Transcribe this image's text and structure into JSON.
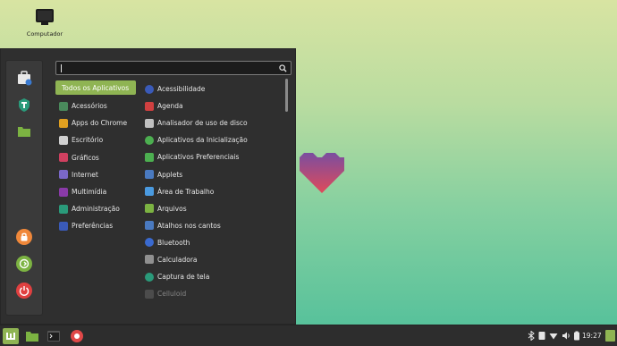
{
  "desktop": {
    "icon_label": "Computador"
  },
  "search": {
    "value": ""
  },
  "categories": [
    {
      "label": "Todos os Aplicativos",
      "icon": "all-apps",
      "color": "#8fb453",
      "active": true
    },
    {
      "label": "Acessórios",
      "icon": "accessories-icon",
      "color": "#4a8a5c"
    },
    {
      "label": "Apps do Chrome",
      "icon": "chrome-icon",
      "color": "#e0a020"
    },
    {
      "label": "Escritório",
      "icon": "office-icon",
      "color": "#d0d0d0"
    },
    {
      "label": "Gráficos",
      "icon": "graphics-icon",
      "color": "#d04060"
    },
    {
      "label": "Internet",
      "icon": "internet-icon",
      "color": "#7a68c8"
    },
    {
      "label": "Multimídia",
      "icon": "multimedia-icon",
      "color": "#8a3aa8"
    },
    {
      "label": "Administração",
      "icon": "administration-icon",
      "color": "#2a9a7a"
    },
    {
      "label": "Preferências",
      "icon": "preferences-icon",
      "color": "#3a5ab8"
    }
  ],
  "apps": [
    {
      "label": "Acessibilidade",
      "icon": "accessibility-icon",
      "color": "#3a5ab8"
    },
    {
      "label": "Agenda",
      "icon": "calendar-icon",
      "color": "#d04040"
    },
    {
      "label": "Analisador de uso de disco",
      "icon": "disk-usage-icon",
      "color": "#c0c0c0"
    },
    {
      "label": "Aplicativos da Inicialização",
      "icon": "startup-apps-icon",
      "color": "#4caf50"
    },
    {
      "label": "Aplicativos Preferenciais",
      "icon": "preferred-apps-icon",
      "color": "#4caf50"
    },
    {
      "label": "Applets",
      "icon": "applets-icon",
      "color": "#4a7ac0"
    },
    {
      "label": "Área de Trabalho",
      "icon": "desktop-icon",
      "color": "#4a9ae0"
    },
    {
      "label": "Arquivos",
      "icon": "files-icon",
      "color": "#7cb342"
    },
    {
      "label": "Atalhos nos cantos",
      "icon": "hot-corners-icon",
      "color": "#4a7ac0"
    },
    {
      "label": "Bluetooth",
      "icon": "bluetooth-icon",
      "color": "#3a6ad0"
    },
    {
      "label": "Calculadora",
      "icon": "calculator-icon",
      "color": "#909090"
    },
    {
      "label": "Captura de tela",
      "icon": "screenshot-icon",
      "color": "#2a9a7a"
    },
    {
      "label": "Celluloid",
      "icon": "celluloid-icon",
      "color": "#707070",
      "dim": true
    }
  ],
  "favorites": [
    {
      "name": "software-icon",
      "color": "#e8e8e8"
    },
    {
      "name": "system-settings-icon",
      "color": "#2a9a7a"
    },
    {
      "name": "files-icon",
      "color": "#7cb342"
    },
    {
      "name": "lock-screen-icon",
      "color": "#f0883a"
    },
    {
      "name": "logout-icon",
      "color": "#7cb342"
    },
    {
      "name": "power-icon",
      "color": "#e04040"
    }
  ],
  "panel": {
    "clock": "19:27",
    "menu_color": "#8fb453"
  }
}
